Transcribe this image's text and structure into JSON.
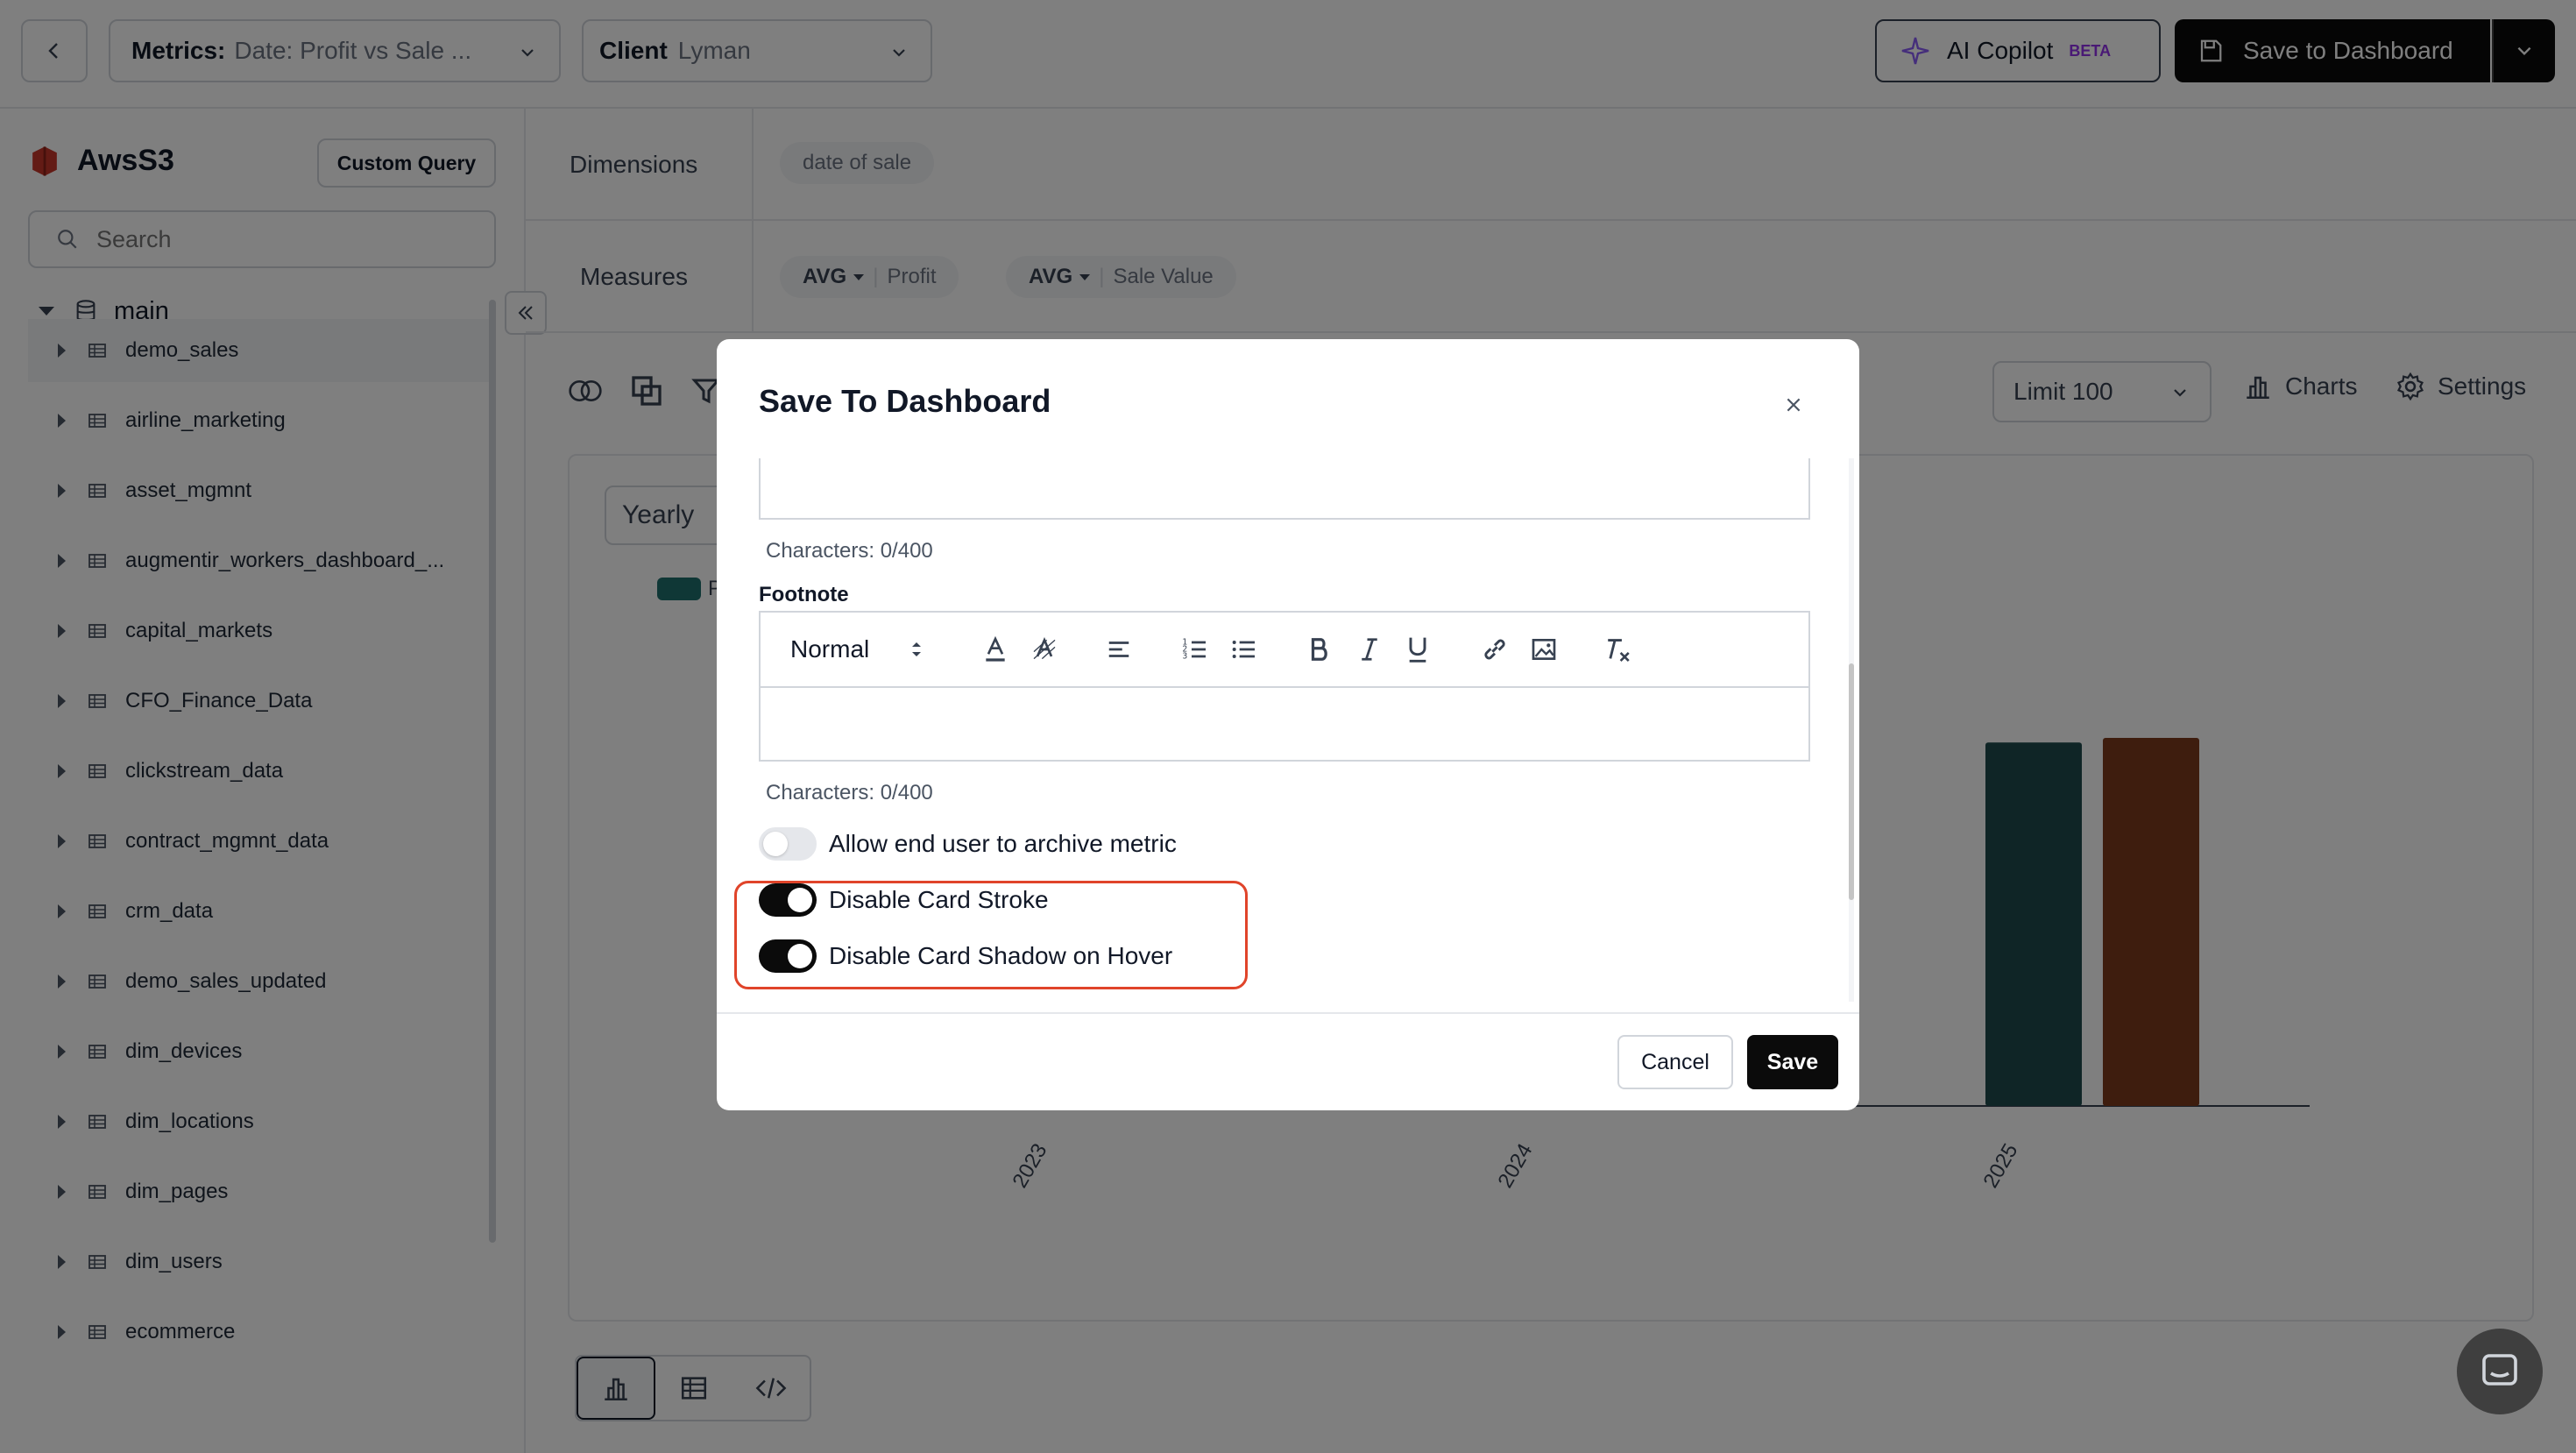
{
  "header": {
    "back_icon": "chevron-left-icon",
    "metrics_label": "Metrics:",
    "metrics_value": "Date: Profit vs Sale ...",
    "client_label": "Client",
    "client_value": "Lyman",
    "copilot_label": "AI Copilot",
    "copilot_badge": "BETA",
    "save_dashboard_label": "Save to Dashboard"
  },
  "sidebar": {
    "source_name": "AwsS3",
    "custom_query_label": "Custom Query",
    "search_placeholder": "Search",
    "schema_name": "main",
    "tables": [
      "demo_sales",
      "airline_marketing",
      "asset_mgmnt",
      "augmentir_workers_dashboard_...",
      "capital_markets",
      "CFO_Finance_Data",
      "clickstream_data",
      "contract_mgmnt_data",
      "crm_data",
      "demo_sales_updated",
      "dim_devices",
      "dim_locations",
      "dim_pages",
      "dim_users",
      "ecommerce"
    ]
  },
  "query": {
    "dimensions_label": "Dimensions",
    "dimension_chip": "date of sale",
    "measures_label": "Measures",
    "measures": [
      {
        "agg": "AVG",
        "field": "Profit"
      },
      {
        "agg": "AVG",
        "field": "Sale Value"
      }
    ],
    "limit_label": "Limit 100",
    "charts_label": "Charts",
    "settings_label": "Settings",
    "granularity": "Yearly",
    "legend_partial": "P"
  },
  "chart_data": {
    "type": "bar",
    "categories": [
      "2023",
      "2024",
      "2025"
    ],
    "series": [
      {
        "color": "#1f4a4c",
        "values": [
          null,
          null,
          395
        ]
      },
      {
        "color": "#7c3a1c",
        "values": [
          null,
          null,
          400
        ]
      }
    ]
  },
  "modal": {
    "title": "Save To Dashboard",
    "description_chars": "Characters: 0/400",
    "footnote_label": "Footnote",
    "format_select": "Normal",
    "footnote_chars": "Characters: 0/400",
    "toggles": [
      {
        "label": "Allow end user to archive metric",
        "on": false
      },
      {
        "label": "Disable Card Stroke",
        "on": true
      },
      {
        "label": "Disable Card Shadow on Hover",
        "on": true
      }
    ],
    "cancel_label": "Cancel",
    "save_label": "Save"
  },
  "colors": {
    "highlight": "#e0442a",
    "dark": "#0b0b0b",
    "overlay": "rgba(0,0,0,0.5)"
  }
}
